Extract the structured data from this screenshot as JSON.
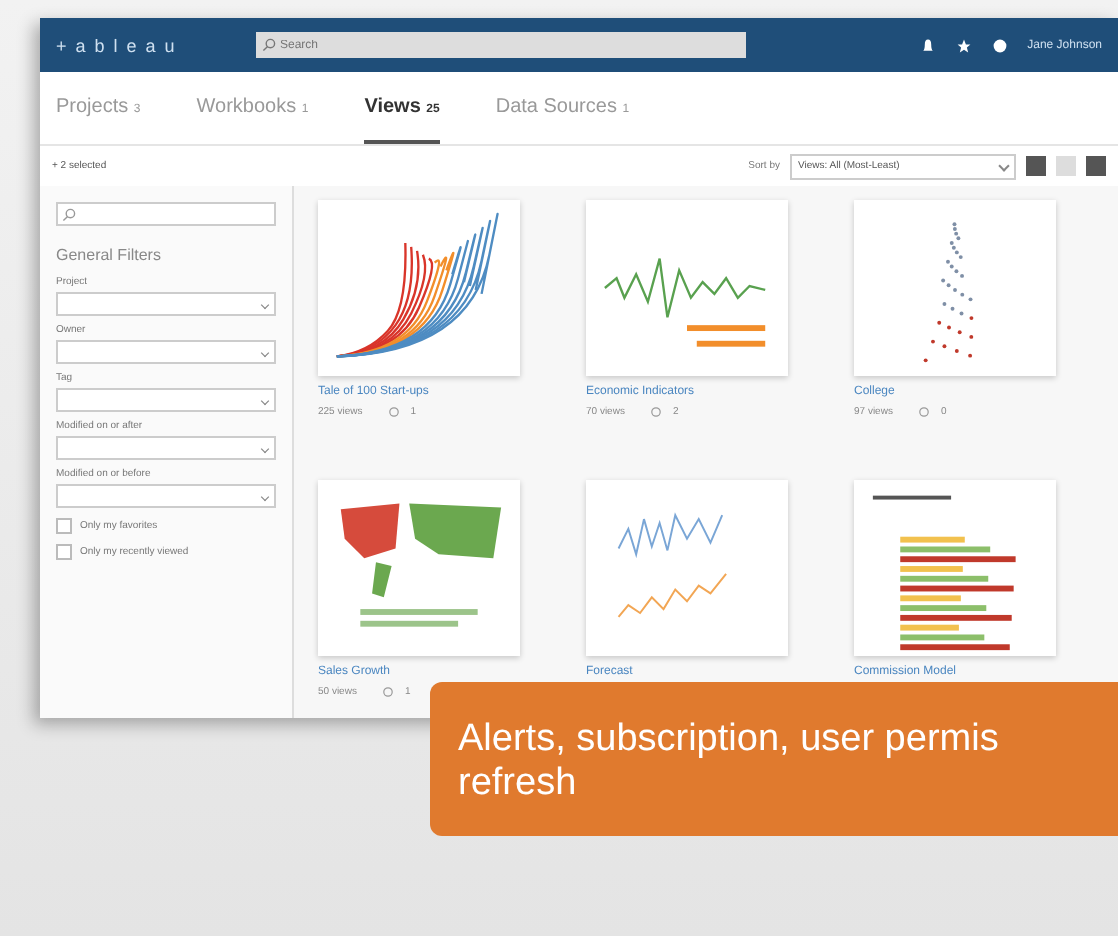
{
  "header": {
    "logo": "+ a b l e a u",
    "search": {
      "placeholder": "Search"
    },
    "user": "Jane Johnson"
  },
  "tabs": [
    {
      "label": "Projects",
      "count": "3",
      "selected": false
    },
    {
      "label": "Workbooks",
      "count": "1",
      "selected": false
    },
    {
      "label": "Views",
      "count": "25",
      "selected": true
    },
    {
      "label": "Data Sources",
      "count": "1",
      "selected": false
    }
  ],
  "toolbar": {
    "selection": "+ 2 selected",
    "sort_label": "Sort by",
    "sort_value": "Views: All (Most-Least)"
  },
  "sidebar": {
    "title": "General Filters",
    "filters": [
      "Project",
      "Owner",
      "Tag",
      "Modified on or after",
      "Modified on or before"
    ],
    "checkboxes": [
      {
        "label": "Only my favorites",
        "checked": false
      },
      {
        "label": "Only my recently viewed",
        "checked": false
      }
    ]
  },
  "views": [
    {
      "title": "Tale of 100 Start-ups",
      "views": "225 views",
      "comments": "1",
      "kind": "lines"
    },
    {
      "title": "Economic Indicators",
      "views": "70 views",
      "comments": "2",
      "kind": "wave"
    },
    {
      "title": "College",
      "views": "97 views",
      "comments": "0",
      "kind": "scatter"
    },
    {
      "title": "Sales Growth",
      "views": "50 views",
      "comments": "1",
      "kind": "map"
    },
    {
      "title": "Forecast",
      "kind": "forecast"
    },
    {
      "title": "Commission Model",
      "kind": "bars"
    }
  ],
  "callout": [
    "Alerts, subscription, user permis",
    "refresh"
  ]
}
